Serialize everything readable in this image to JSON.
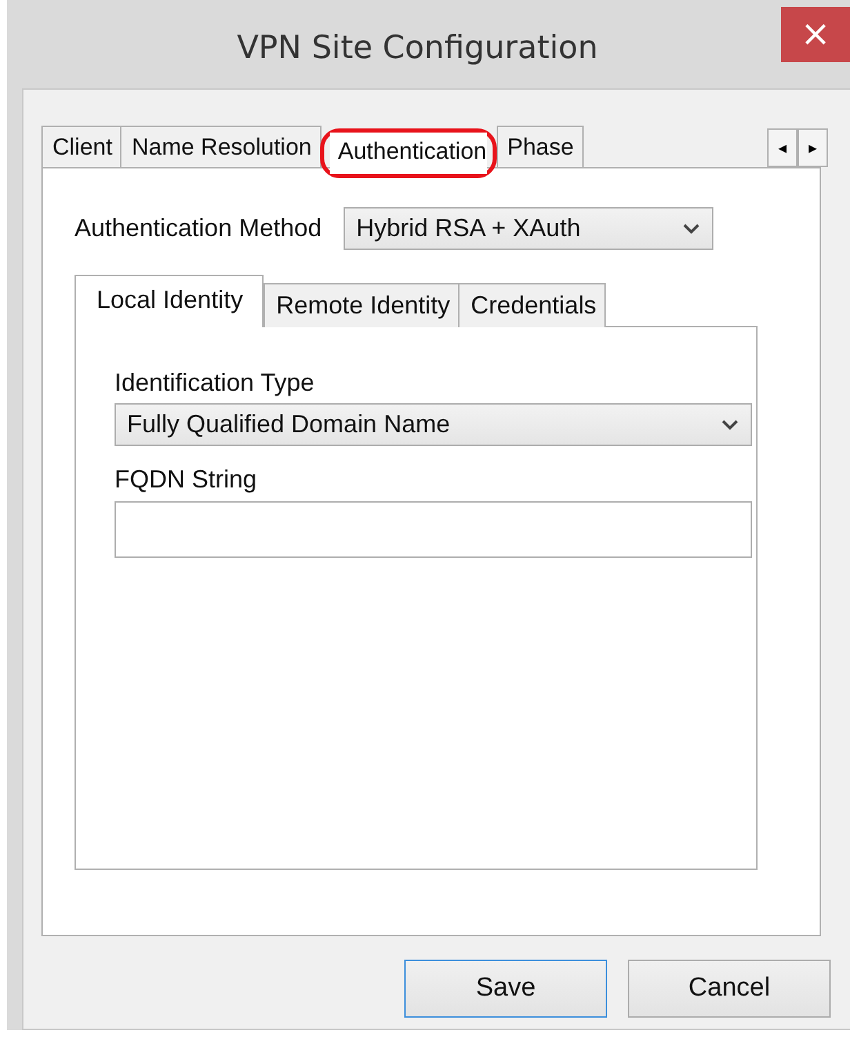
{
  "window": {
    "title": "VPN Site Configuration",
    "close": "×"
  },
  "tabs": [
    {
      "label": "Client",
      "selected": false,
      "highlighted": false
    },
    {
      "label": "Name Resolution",
      "selected": false,
      "highlighted": false
    },
    {
      "label": "Authentication",
      "selected": true,
      "highlighted": true
    },
    {
      "label": "Phase",
      "selected": false,
      "highlighted": false
    }
  ],
  "tab_scroll": [
    "◂",
    "▸"
  ],
  "auth_method": {
    "label": "Authentication Method",
    "value": "Hybrid RSA + XAuth"
  },
  "subtabs": [
    {
      "label": "Local Identity",
      "selected": true
    },
    {
      "label": "Remote Identity",
      "selected": false
    },
    {
      "label": "Credentials",
      "selected": false
    }
  ],
  "identification_type": {
    "label": "Identification Type",
    "value": "Fully Qualified Domain Name"
  },
  "fqdn": {
    "label": "FQDN String"
  },
  "buttons": [
    {
      "label": "Save",
      "default": true
    },
    {
      "label": "Cancel",
      "default": false
    }
  ]
}
